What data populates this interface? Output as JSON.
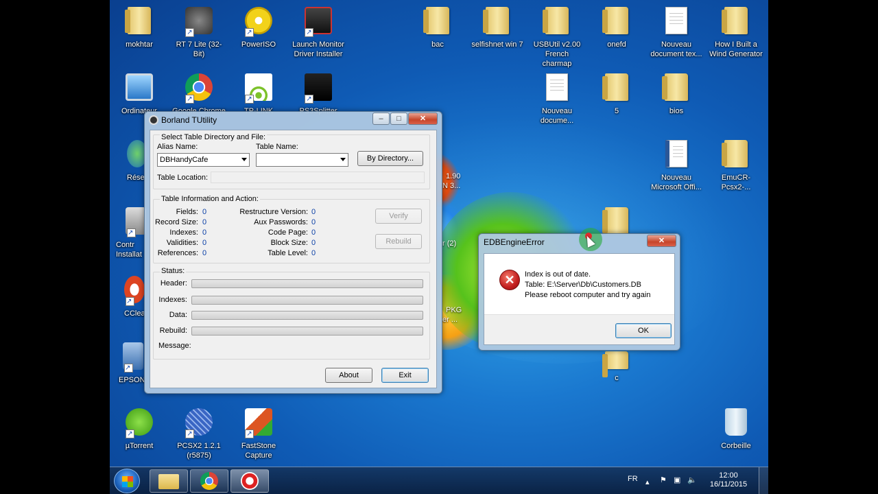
{
  "desktop_icons": [
    {
      "label": "mokhtar",
      "icon": "user-folder-icon"
    },
    {
      "label": "RT 7 Lite (32-Bit)",
      "icon": "rt7-icon"
    },
    {
      "label": "PowerISO",
      "icon": "poweriso-icon"
    },
    {
      "label": "Launch Monitor Driver Installer",
      "icon": "installer-icon"
    },
    {
      "label": "bac",
      "icon": "folder-icon"
    },
    {
      "label": "selfishnet win 7",
      "icon": "folder-icon"
    },
    {
      "label": "USBUtil v2.00 French charmap",
      "icon": "folder-icon"
    },
    {
      "label": "onefd",
      "icon": "folder-icon"
    },
    {
      "label": "Nouveau document tex...",
      "icon": "text-document-icon"
    },
    {
      "label": "How I Built a Wind Generator",
      "icon": "folder-icon"
    },
    {
      "label": "Ordinateur",
      "icon": "computer-icon"
    },
    {
      "label": "Google Chrome",
      "icon": "chrome-icon"
    },
    {
      "label": "TP-LINK",
      "icon": "tplink-icon"
    },
    {
      "label": "PS3Splitter",
      "icon": "ps3-icon"
    },
    {
      "label": "Nouveau docume...",
      "icon": "document-icon"
    },
    {
      "label": "5",
      "icon": "folder-icon"
    },
    {
      "label": "bios",
      "icon": "folder-icon"
    },
    {
      "label": "Nouveau Microsoft Offi...",
      "icon": "word-document-icon"
    },
    {
      "label": "EmuCR-Pcsx2-...",
      "icon": "folder-icon"
    },
    {
      "label": "Rése",
      "icon": "network-icon"
    },
    {
      "label": "Contr Installat",
      "icon": "control-icon"
    },
    {
      "label": "CClea",
      "icon": "ccleaner-icon"
    },
    {
      "label": "EPSON",
      "icon": "epson-icon"
    },
    {
      "label": "µTorrent",
      "icon": "utorrent-icon"
    },
    {
      "label": "PCSX2 1.2.1 (r5875)",
      "icon": "pcsx2-icon"
    },
    {
      "label": "FastStone Capture",
      "icon": "faststone-icon"
    },
    {
      "label": "Corbeille",
      "icon": "recycle-bin-icon"
    },
    {
      "label": "c",
      "icon": "folder-icon"
    }
  ],
  "partial_labels": [
    "1.90",
    "N 3...",
    "r (2)",
    "PKG",
    "er ..."
  ],
  "tutility": {
    "title": "Borland TUtility",
    "select_group": "Select Table Directory and File:",
    "alias_label": "Alias Name:",
    "alias_value": "DBHandyCafe",
    "table_label": "Table Name:",
    "table_value": "",
    "by_directory": "By Directory...",
    "table_location": "Table Location:",
    "info_group": "Table Information and Action:",
    "left_fields": [
      {
        "label": "Fields:",
        "value": "0"
      },
      {
        "label": "Record Size:",
        "value": "0"
      },
      {
        "label": "Indexes:",
        "value": "0"
      },
      {
        "label": "Validities:",
        "value": "0"
      },
      {
        "label": "References:",
        "value": "0"
      }
    ],
    "right_fields": [
      {
        "label": "Restructure Version:",
        "value": "0"
      },
      {
        "label": "Aux Passwords:",
        "value": "0"
      },
      {
        "label": "Code Page:",
        "value": "0"
      },
      {
        "label": "Block Size:",
        "value": "0"
      },
      {
        "label": "Table Level:",
        "value": "0"
      }
    ],
    "verify": "Verify",
    "rebuild": "Rebuild",
    "status_label": "Status:",
    "status_rows": [
      "Header:",
      "Indexes:",
      "Data:",
      "Rebuild:"
    ],
    "message_label": "Message:",
    "about": "About",
    "exit": "Exit"
  },
  "error_dialog": {
    "title": "EDBEngineError",
    "line1": "Index is out of date.",
    "line2": "Table: E:\\Server\\Db\\Customers.DB",
    "line3": "Please reboot computer and try again",
    "ok": "OK"
  },
  "taskbar": {
    "language": "FR",
    "time": "12:00",
    "date": "16/11/2015"
  }
}
